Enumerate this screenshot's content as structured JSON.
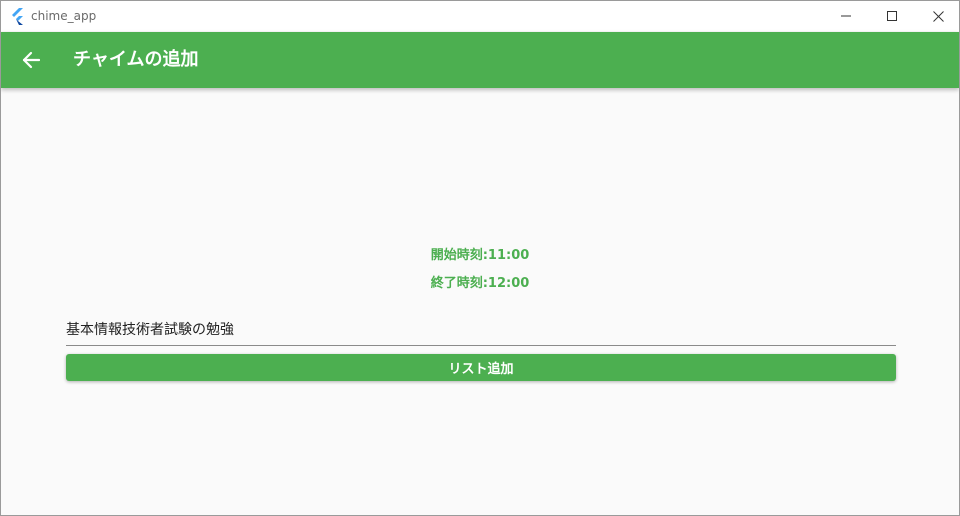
{
  "window": {
    "title": "chime_app",
    "controls": {
      "minimize_icon": "minimize-icon",
      "maximize_icon": "maximize-icon",
      "close_icon": "close-icon"
    }
  },
  "appbar": {
    "back_icon": "arrow-back-icon",
    "title": "チャイムの追加",
    "background_color": "#4caf50"
  },
  "form": {
    "start_time": "開始時刻:11:00",
    "end_time": "終了時刻:12:00",
    "title_value": "基本情報技術者試験の勉強",
    "submit_label": "リスト追加"
  },
  "colors": {
    "accent": "#4caf50",
    "background": "#fafafa"
  }
}
